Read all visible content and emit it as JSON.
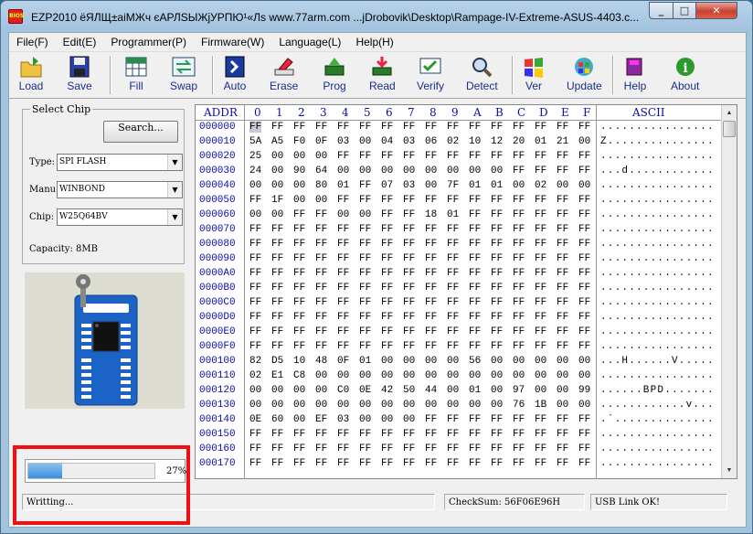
{
  "window": {
    "title": "EZP2010 ёЯЛЩ±аіМЖч єАРЛЅЫЖјУРПЮ¹«Лѕ www.77arm.com    ...jDrobovik\\Desktop\\Rampage-IV-Extreme-ASUS-4403.c..."
  },
  "menu": [
    "File(F)",
    "Edit(E)",
    "Programmer(P)",
    "Firmware(W)",
    "Language(L)",
    "Help(H)"
  ],
  "toolbar": [
    {
      "label": "Load",
      "icon": "folder-open-icon"
    },
    {
      "label": "Save",
      "icon": "floppy-disk-icon"
    },
    {
      "label": "Fill",
      "icon": "fill-grid-icon"
    },
    {
      "label": "Swap",
      "icon": "swap-arrows-icon"
    },
    {
      "label": "Auto",
      "icon": "auto-download-icon"
    },
    {
      "label": "Erase",
      "icon": "eraser-icon"
    },
    {
      "label": "Prog",
      "icon": "program-chip-icon"
    },
    {
      "label": "Read",
      "icon": "read-chip-icon"
    },
    {
      "label": "Verify",
      "icon": "verify-chip-icon"
    },
    {
      "label": "Detect",
      "icon": "magnifier-icon"
    },
    {
      "label": "Ver",
      "icon": "windows-flag-icon"
    },
    {
      "label": "Update",
      "icon": "windows-globe-icon"
    },
    {
      "label": "Help",
      "icon": "help-book-icon"
    },
    {
      "label": "About",
      "icon": "info-icon"
    }
  ],
  "chip_panel": {
    "legend": "Select Chip",
    "search_label": "Search...",
    "type_label": "Type:",
    "type_value": "SPI FLASH",
    "manu_label": "Manu:",
    "manu_value": "WINBOND",
    "chip_label": "Chip:",
    "chip_value": "W25Q64BV",
    "capacity": "Capacity: 8MB"
  },
  "progress": {
    "percent_text": "27%",
    "fraction": 0.27
  },
  "hex": {
    "addr_header": "ADDR",
    "ascii_header": "ASCII",
    "columns": [
      "0",
      "1",
      "2",
      "3",
      "4",
      "5",
      "6",
      "7",
      "8",
      "9",
      "A",
      "B",
      "C",
      "D",
      "E",
      "F"
    ],
    "rows": [
      {
        "addr": "000000",
        "bytes": [
          "FF",
          "FF",
          "FF",
          "FF",
          "FF",
          "FF",
          "FF",
          "FF",
          "FF",
          "FF",
          "FF",
          "FF",
          "FF",
          "FF",
          "FF",
          "FF"
        ],
        "ascii": "................"
      },
      {
        "addr": "000010",
        "bytes": [
          "5A",
          "A5",
          "F0",
          "0F",
          "03",
          "00",
          "04",
          "03",
          "06",
          "02",
          "10",
          "12",
          "20",
          "01",
          "21",
          "00"
        ],
        "ascii": "Z..............."
      },
      {
        "addr": "000020",
        "bytes": [
          "25",
          "00",
          "00",
          "00",
          "FF",
          "FF",
          "FF",
          "FF",
          "FF",
          "FF",
          "FF",
          "FF",
          "FF",
          "FF",
          "FF",
          "FF"
        ],
        "ascii": "................"
      },
      {
        "addr": "000030",
        "bytes": [
          "24",
          "00",
          "90",
          "64",
          "00",
          "00",
          "00",
          "00",
          "00",
          "00",
          "00",
          "00",
          "FF",
          "FF",
          "FF",
          "FF"
        ],
        "ascii": "...d............"
      },
      {
        "addr": "000040",
        "bytes": [
          "00",
          "00",
          "00",
          "80",
          "01",
          "FF",
          "07",
          "03",
          "00",
          "7F",
          "01",
          "01",
          "00",
          "02",
          "00",
          "00"
        ],
        "ascii": "................"
      },
      {
        "addr": "000050",
        "bytes": [
          "FF",
          "1F",
          "00",
          "00",
          "FF",
          "FF",
          "FF",
          "FF",
          "FF",
          "FF",
          "FF",
          "FF",
          "FF",
          "FF",
          "FF",
          "FF"
        ],
        "ascii": "................"
      },
      {
        "addr": "000060",
        "bytes": [
          "00",
          "00",
          "FF",
          "FF",
          "00",
          "00",
          "FF",
          "FF",
          "18",
          "01",
          "FF",
          "FF",
          "FF",
          "FF",
          "FF",
          "FF"
        ],
        "ascii": "................"
      },
      {
        "addr": "000070",
        "bytes": [
          "FF",
          "FF",
          "FF",
          "FF",
          "FF",
          "FF",
          "FF",
          "FF",
          "FF",
          "FF",
          "FF",
          "FF",
          "FF",
          "FF",
          "FF",
          "FF"
        ],
        "ascii": "................"
      },
      {
        "addr": "000080",
        "bytes": [
          "FF",
          "FF",
          "FF",
          "FF",
          "FF",
          "FF",
          "FF",
          "FF",
          "FF",
          "FF",
          "FF",
          "FF",
          "FF",
          "FF",
          "FF",
          "FF"
        ],
        "ascii": "................"
      },
      {
        "addr": "000090",
        "bytes": [
          "FF",
          "FF",
          "FF",
          "FF",
          "FF",
          "FF",
          "FF",
          "FF",
          "FF",
          "FF",
          "FF",
          "FF",
          "FF",
          "FF",
          "FF",
          "FF"
        ],
        "ascii": "................"
      },
      {
        "addr": "0000A0",
        "bytes": [
          "FF",
          "FF",
          "FF",
          "FF",
          "FF",
          "FF",
          "FF",
          "FF",
          "FF",
          "FF",
          "FF",
          "FF",
          "FF",
          "FF",
          "FF",
          "FF"
        ],
        "ascii": "................"
      },
      {
        "addr": "0000B0",
        "bytes": [
          "FF",
          "FF",
          "FF",
          "FF",
          "FF",
          "FF",
          "FF",
          "FF",
          "FF",
          "FF",
          "FF",
          "FF",
          "FF",
          "FF",
          "FF",
          "FF"
        ],
        "ascii": "................"
      },
      {
        "addr": "0000C0",
        "bytes": [
          "FF",
          "FF",
          "FF",
          "FF",
          "FF",
          "FF",
          "FF",
          "FF",
          "FF",
          "FF",
          "FF",
          "FF",
          "FF",
          "FF",
          "FF",
          "FF"
        ],
        "ascii": "................"
      },
      {
        "addr": "0000D0",
        "bytes": [
          "FF",
          "FF",
          "FF",
          "FF",
          "FF",
          "FF",
          "FF",
          "FF",
          "FF",
          "FF",
          "FF",
          "FF",
          "FF",
          "FF",
          "FF",
          "FF"
        ],
        "ascii": "................"
      },
      {
        "addr": "0000E0",
        "bytes": [
          "FF",
          "FF",
          "FF",
          "FF",
          "FF",
          "FF",
          "FF",
          "FF",
          "FF",
          "FF",
          "FF",
          "FF",
          "FF",
          "FF",
          "FF",
          "FF"
        ],
        "ascii": "................"
      },
      {
        "addr": "0000F0",
        "bytes": [
          "FF",
          "FF",
          "FF",
          "FF",
          "FF",
          "FF",
          "FF",
          "FF",
          "FF",
          "FF",
          "FF",
          "FF",
          "FF",
          "FF",
          "FF",
          "FF"
        ],
        "ascii": "................"
      },
      {
        "addr": "000100",
        "bytes": [
          "82",
          "D5",
          "10",
          "48",
          "0F",
          "01",
          "00",
          "00",
          "00",
          "00",
          "56",
          "00",
          "00",
          "00",
          "00",
          "00"
        ],
        "ascii": "...H......V....."
      },
      {
        "addr": "000110",
        "bytes": [
          "02",
          "E1",
          "C8",
          "00",
          "00",
          "00",
          "00",
          "00",
          "00",
          "00",
          "00",
          "00",
          "00",
          "00",
          "00",
          "00"
        ],
        "ascii": "................"
      },
      {
        "addr": "000120",
        "bytes": [
          "00",
          "00",
          "00",
          "00",
          "C0",
          "0E",
          "42",
          "50",
          "44",
          "00",
          "01",
          "00",
          "97",
          "00",
          "00",
          "99"
        ],
        "ascii": "......BPD......."
      },
      {
        "addr": "000130",
        "bytes": [
          "00",
          "00",
          "00",
          "00",
          "00",
          "00",
          "00",
          "00",
          "00",
          "00",
          "00",
          "00",
          "76",
          "1B",
          "00",
          "00"
        ],
        "ascii": "............v..."
      },
      {
        "addr": "000140",
        "bytes": [
          "0E",
          "60",
          "00",
          "EF",
          "03",
          "00",
          "00",
          "00",
          "FF",
          "FF",
          "FF",
          "FF",
          "FF",
          "FF",
          "FF",
          "FF"
        ],
        "ascii": ".`.............."
      },
      {
        "addr": "000150",
        "bytes": [
          "FF",
          "FF",
          "FF",
          "FF",
          "FF",
          "FF",
          "FF",
          "FF",
          "FF",
          "FF",
          "FF",
          "FF",
          "FF",
          "FF",
          "FF",
          "FF"
        ],
        "ascii": "................"
      },
      {
        "addr": "000160",
        "bytes": [
          "FF",
          "FF",
          "FF",
          "FF",
          "FF",
          "FF",
          "FF",
          "FF",
          "FF",
          "FF",
          "FF",
          "FF",
          "FF",
          "FF",
          "FF",
          "FF"
        ],
        "ascii": "................"
      },
      {
        "addr": "000170",
        "bytes": [
          "FF",
          "FF",
          "FF",
          "FF",
          "FF",
          "FF",
          "FF",
          "FF",
          "FF",
          "FF",
          "FF",
          "FF",
          "FF",
          "FF",
          "FF",
          "FF"
        ],
        "ascii": "................"
      }
    ]
  },
  "status": {
    "message": "Writting...",
    "checksum": "CheckSum: 56F06E96H",
    "link": "USB Link OK!"
  }
}
